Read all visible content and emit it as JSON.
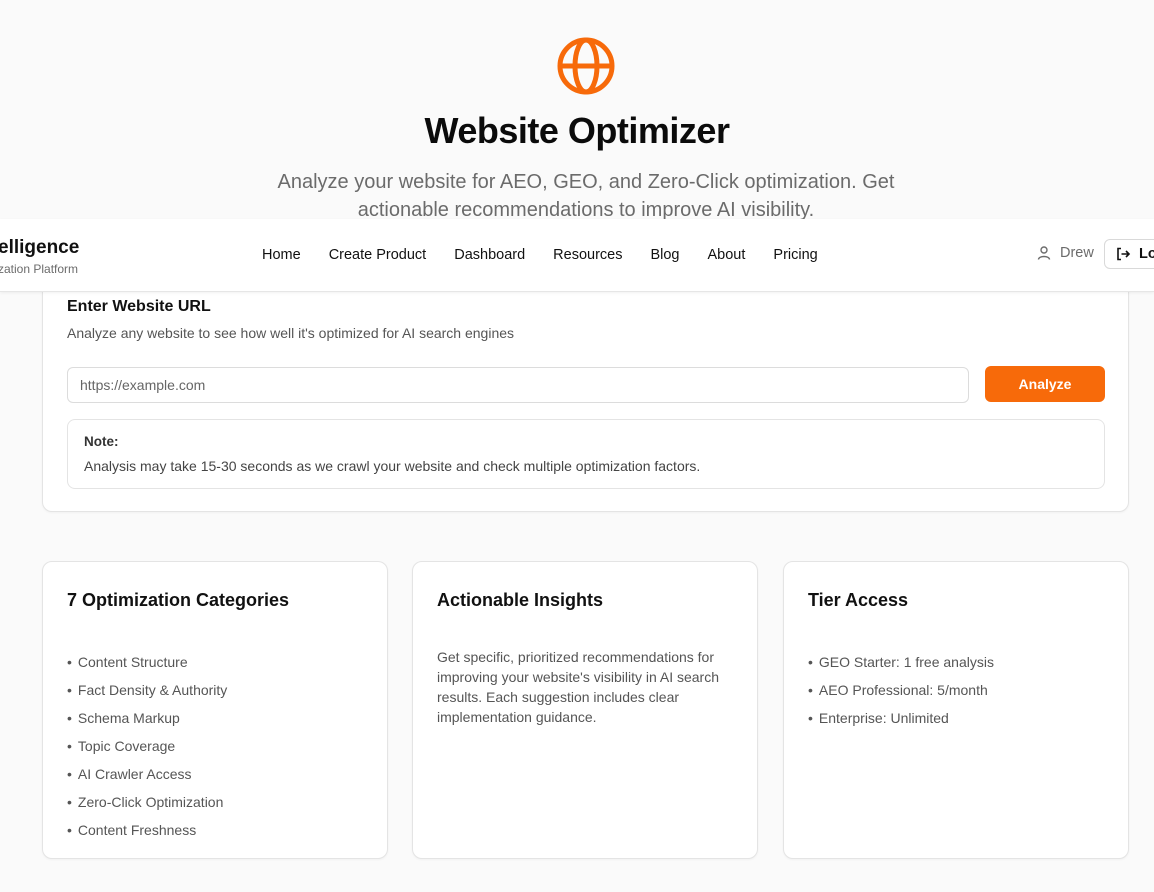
{
  "hero": {
    "icon": "globe-icon",
    "title": "Website Optimizer",
    "subtitle": "Analyze your website for AEO, GEO, and Zero-Click optimization. Get actionable recommendations to improve AI visibility."
  },
  "navbar": {
    "brand_title": "elligence",
    "brand_subtitle": "zation Platform",
    "links": [
      "Home",
      "Create Product",
      "Dashboard",
      "Resources",
      "Blog",
      "About",
      "Pricing"
    ],
    "user_name": "Drew",
    "logout_label": "Lo"
  },
  "url_card": {
    "title": "Enter Website URL",
    "description": "Analyze any website to see how well it's optimized for AI search engines",
    "input_value": "",
    "input_placeholder": "https://example.com",
    "analyze_label": "Analyze",
    "note_title": "Note:",
    "note_text": "Analysis may take 15-30 seconds as we crawl your website and check multiple optimization factors."
  },
  "cards": {
    "categories": {
      "title": "7 Optimization Categories",
      "items": [
        "Content Structure",
        "Fact Density & Authority",
        "Schema Markup",
        "Topic Coverage",
        "AI Crawler Access",
        "Zero-Click Optimization",
        "Content Freshness"
      ]
    },
    "insights": {
      "title": "Actionable Insights",
      "text": "Get specific, prioritized recommendations for improving your website's visibility in AI search results. Each suggestion includes clear implementation guidance."
    },
    "tiers": {
      "title": "Tier Access",
      "items": [
        "GEO Starter: 1 free analysis",
        "AEO Professional: 5/month",
        "Enterprise: Unlimited"
      ]
    }
  },
  "colors": {
    "accent": "#f76a0a",
    "background": "#fafafa",
    "card": "#ffffff",
    "text": "#111111",
    "muted_text": "#6b6b6b"
  }
}
